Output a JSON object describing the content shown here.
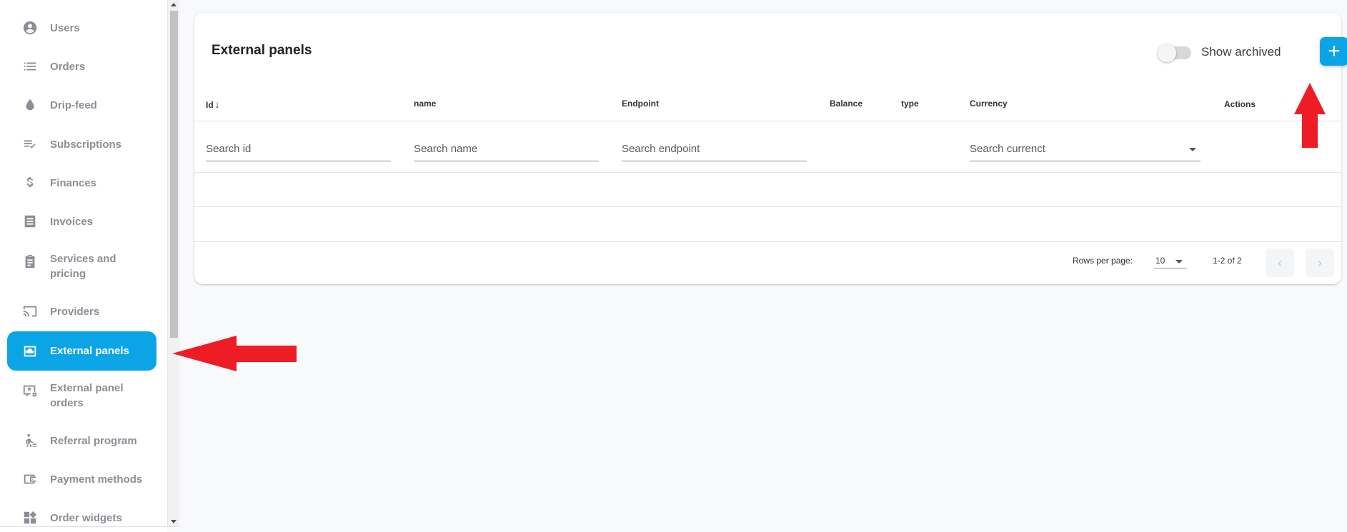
{
  "sidebar": {
    "items": [
      {
        "label": "Users",
        "icon": "account-circle-icon",
        "active": false
      },
      {
        "label": "Orders",
        "icon": "list-icon",
        "active": false
      },
      {
        "label": "Drip-feed",
        "icon": "drop-icon",
        "active": false
      },
      {
        "label": "Subscriptions",
        "icon": "playlist-check-icon",
        "active": false
      },
      {
        "label": "Finances",
        "icon": "dollar-icon",
        "active": false
      },
      {
        "label": "Invoices",
        "icon": "invoice-icon",
        "active": false
      },
      {
        "label": "Services and pricing",
        "icon": "clipboard-icon",
        "active": false
      },
      {
        "label": "Providers",
        "icon": "cast-icon",
        "active": false
      },
      {
        "label": "External panels",
        "icon": "cloud-panel-icon",
        "active": true
      },
      {
        "label": "External panel orders",
        "icon": "monitor-star-icon",
        "active": false
      },
      {
        "label": "Referral program",
        "icon": "walk-icon",
        "active": false
      },
      {
        "label": "Payment methods",
        "icon": "wallet-icon",
        "active": false
      },
      {
        "label": "Order widgets",
        "icon": "widgets-icon",
        "active": false
      }
    ]
  },
  "card": {
    "title": "External panels",
    "show_archived_label": "Show archived",
    "show_archived": false,
    "add_button_label": "+"
  },
  "table": {
    "columns": [
      "Id",
      "name",
      "Endpoint",
      "Balance",
      "type",
      "Currency",
      "Actions"
    ],
    "sort_indicator": "↓",
    "search": {
      "id_placeholder": "Search id",
      "name_placeholder": "Search name",
      "endpoint_placeholder": "Search endpoint",
      "currency_placeholder": "Search currenct"
    },
    "rows": [
      {},
      {}
    ]
  },
  "pagination": {
    "rows_per_page_label": "Rows per page:",
    "rows_per_page_value": "10",
    "range_text": "1-2 of 2",
    "prev_glyph": "‹",
    "next_glyph": "›"
  },
  "colors": {
    "accent": "#0ba5e6",
    "annotation_arrow": "#ee1c25"
  }
}
